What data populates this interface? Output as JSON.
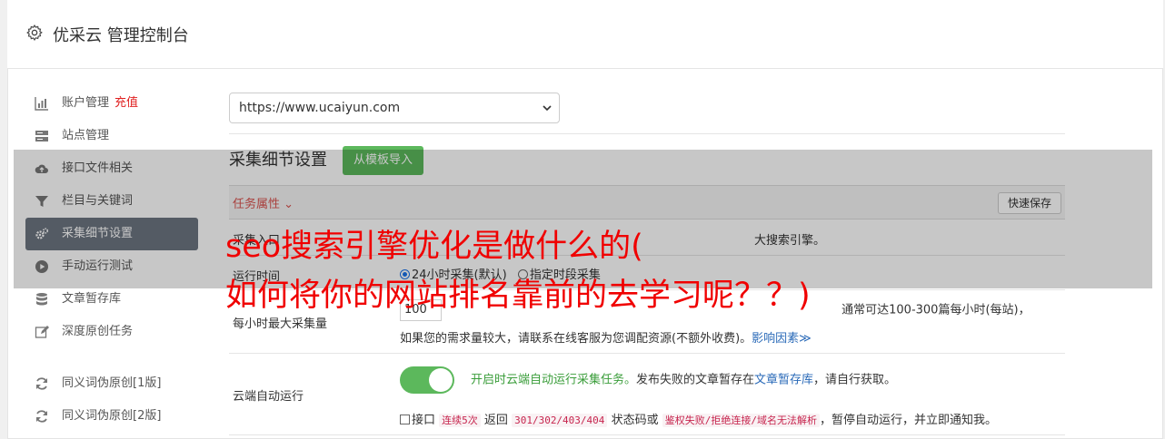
{
  "header": {
    "title": "优采云 管理控制台",
    "icon": "gear-icon"
  },
  "sidebar": {
    "items": [
      {
        "label": "账户管理",
        "extra": "充值",
        "icon": "bar-chart-icon"
      },
      {
        "label": "站点管理",
        "icon": "server-icon"
      },
      {
        "label": "接口文件相关",
        "icon": "cloud-upload-icon"
      },
      {
        "label": "栏目与关键词",
        "icon": "filter-icon"
      },
      {
        "label": "采集细节设置",
        "icon": "cogs-icon",
        "active": true
      },
      {
        "label": "手动运行测试",
        "icon": "play-circle-icon"
      },
      {
        "label": "文章暂存库",
        "icon": "database-icon"
      },
      {
        "label": "深度原创任务",
        "icon": "edit-icon"
      },
      {
        "label": "同义词伪原创[1版]",
        "icon": "refresh-icon"
      },
      {
        "label": "同义词伪原创[2版]",
        "icon": "refresh-icon"
      }
    ]
  },
  "main": {
    "site_select": "https://www.ucaiyun.com",
    "section_title": "采集细节设置",
    "template_button": "从模板导入",
    "task_tab": "任务属性 ⌄",
    "quick_save": "快速保存",
    "row_entry": {
      "label": "采集入口",
      "value": "大搜索引擎。"
    },
    "row_runtime": {
      "label": "运行时间",
      "opt1": "24小时采集(默认)",
      "opt2": "指定时段采集"
    },
    "row_maxrate": {
      "label": "每小时最大采集量",
      "input": "100",
      "text1": "通常可达100-300篇每小时(每站)，",
      "text2": "如果您的需求量较大，请联系在线客服为您调配资源(不额外收费)。",
      "link": "影响因素≫"
    },
    "row_cloud": {
      "label": "云端自动运行",
      "green_text": "开启时云端自动运行采集任务。",
      "text_a": "发布失败的文章暂存在",
      "link": "文章暂存库",
      "text_b": "，请自行获取。",
      "cb_label": "接口",
      "code1": "连续5次",
      "text_c": "返回",
      "code2": "301/302/403/404",
      "text_d": "状态码或",
      "code3": "鉴权失败/拒绝连接/域名无法解析",
      "text_e": "，暂停自动运行，并立即通知我。"
    }
  },
  "overlay": {
    "line1": "seo搜索引擎优化是做什么的(",
    "line2": "如何将你的网站排名靠前的去学习呢？？)"
  },
  "colors": {
    "active_sidebar": "#6c7581",
    "headline_red": "#f00000",
    "button_green": "#5cb85c",
    "recharge_red": "#e02020"
  }
}
